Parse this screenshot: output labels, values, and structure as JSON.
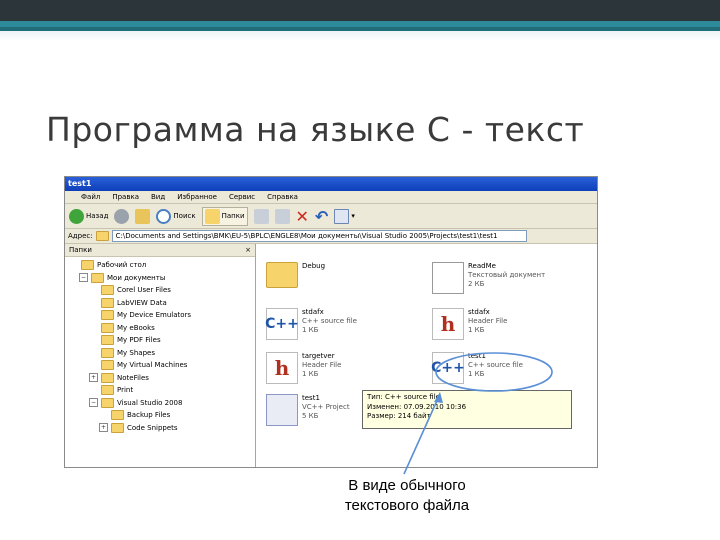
{
  "slide": {
    "title": "Программа на языке С - текст",
    "caption_line1": "В виде обычного",
    "caption_line2": "текстового файла"
  },
  "window": {
    "title": "test1",
    "menu": [
      "Файл",
      "Правка",
      "Вид",
      "Избранное",
      "Сервис",
      "Справка"
    ],
    "toolbar": {
      "back": "Назад",
      "search": "Поиск",
      "folders": "Папки"
    },
    "address_label": "Адрес:",
    "address_value": "C:\\Documents and Settings\\BMK\\EU-5\\BPLC\\ENGLE8\\Мои документы\\Visual Studio 2005\\Projects\\test1\\test1"
  },
  "folders_pane": {
    "header": "Папки",
    "close": "×",
    "items": [
      {
        "label": "Рабочий стол",
        "indent": 0,
        "exp": ""
      },
      {
        "label": "Мои документы",
        "indent": 1,
        "exp": "−"
      },
      {
        "label": "Corel User Files",
        "indent": 2,
        "exp": ""
      },
      {
        "label": "LabVIEW Data",
        "indent": 2,
        "exp": ""
      },
      {
        "label": "My Device Emulators",
        "indent": 2,
        "exp": ""
      },
      {
        "label": "My eBooks",
        "indent": 2,
        "exp": ""
      },
      {
        "label": "My PDF Files",
        "indent": 2,
        "exp": ""
      },
      {
        "label": "My Shapes",
        "indent": 2,
        "exp": ""
      },
      {
        "label": "My Virtual Machines",
        "indent": 2,
        "exp": ""
      },
      {
        "label": "NoteFiles",
        "indent": 2,
        "exp": "+"
      },
      {
        "label": "Print",
        "indent": 2,
        "exp": ""
      },
      {
        "label": "Visual Studio 2008",
        "indent": 2,
        "exp": "−"
      },
      {
        "label": "Backup Files",
        "indent": 3,
        "exp": ""
      },
      {
        "label": "Code Snippets",
        "indent": 3,
        "exp": "+"
      }
    ]
  },
  "files": [
    {
      "name": "Debug",
      "type": "",
      "size": "",
      "icon": "folder-icon"
    },
    {
      "name": "ReadMe",
      "type": "Текстовый документ",
      "size": "2 КБ",
      "icon": "text-document-icon"
    },
    {
      "name": "stdafx",
      "type": "C++ source file",
      "size": "1 КБ",
      "icon": "cpp-file-icon"
    },
    {
      "name": "stdafx",
      "type": "Header File",
      "size": "1 КБ",
      "icon": "header-file-icon"
    },
    {
      "name": "targetver",
      "type": "Header File",
      "size": "1 КБ",
      "icon": "header-file-icon"
    },
    {
      "name": "test1",
      "type": "C++ source file",
      "size": "1 КБ",
      "icon": "cpp-file-icon"
    },
    {
      "name": "test1",
      "type": "VC++ Project",
      "size": "5 КБ",
      "icon": "vc-project-icon"
    }
  ],
  "tooltip": {
    "line1": "Тип: C++ source file",
    "line2": "Изменен: 07.09.2010 10:36",
    "line3": "Размер: 214 байт"
  },
  "colors": {
    "accent": "#2d8b9b",
    "annotation": "#5b8fd6"
  }
}
